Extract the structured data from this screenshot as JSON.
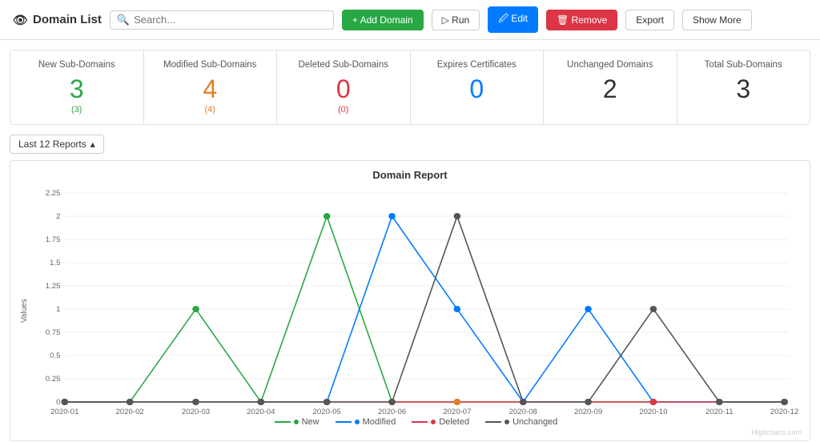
{
  "header": {
    "title": "Domain List",
    "eye_icon": "👁",
    "search_placeholder": "Search...",
    "buttons": {
      "add": "+ Add Domain",
      "run": "▷ Run",
      "edit": "🖉 Edit",
      "remove": "🗑 Remove",
      "export": "Export",
      "show_more": "Show More"
    }
  },
  "stats": [
    {
      "label": "New Sub-Domains",
      "value": "3",
      "sub": "(3)",
      "color": "green"
    },
    {
      "label": "Modified Sub-Domains",
      "value": "4",
      "sub": "(4)",
      "color": "orange"
    },
    {
      "label": "Deleted Sub-Domains",
      "value": "0",
      "sub": "(0)",
      "color": "red"
    },
    {
      "label": "Expires Certificates",
      "value": "0",
      "sub": "",
      "color": "blue"
    },
    {
      "label": "Unchanged Domains",
      "value": "2",
      "sub": "",
      "color": "dark"
    },
    {
      "label": "Total Sub-Domains",
      "value": "3",
      "sub": "",
      "color": "dark"
    }
  ],
  "reports": {
    "dropdown_label": "Last 12 Reports",
    "chart_title": "Domain Report",
    "y_axis_label": "Values",
    "months": [
      "2020-01",
      "2020-02",
      "2020-03",
      "2020-04",
      "2020-05",
      "2020-06",
      "2020-07",
      "2020-08",
      "2020-09",
      "2020-10",
      "2020-11",
      "2020-12"
    ],
    "y_ticks": [
      0,
      0.25,
      0.5,
      0.75,
      1,
      1.25,
      1.5,
      1.75,
      2,
      2.25
    ],
    "series": {
      "new": {
        "label": "New",
        "color": "#28a745",
        "values": [
          0,
          0,
          1,
          0,
          2,
          0,
          0,
          0,
          0,
          0,
          0,
          0
        ]
      },
      "modified": {
        "label": "Modified",
        "color": "#007bff",
        "values": [
          0,
          0,
          0,
          0,
          0,
          2,
          1,
          0,
          1,
          0,
          0,
          0
        ]
      },
      "deleted": {
        "label": "Deleted",
        "color": "#dc3545",
        "values": [
          0,
          0,
          0,
          0,
          0,
          0,
          0,
          0,
          0,
          0,
          0,
          0
        ]
      },
      "unchanged": {
        "label": "Unchanged",
        "color": "#555555",
        "values": [
          0,
          0,
          0,
          0,
          0,
          0,
          2,
          0,
          0,
          1,
          0,
          0
        ]
      }
    },
    "highcharts_credit": "Highcharts.com"
  }
}
